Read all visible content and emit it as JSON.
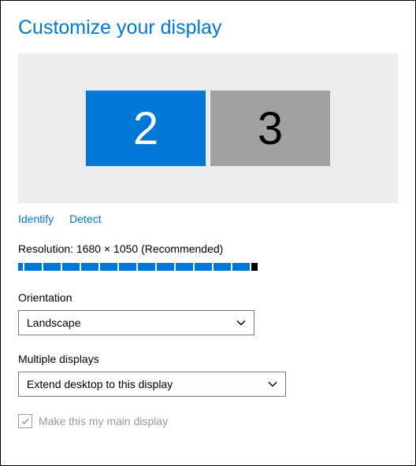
{
  "title": "Customize your display",
  "monitors": {
    "selected": "2",
    "unselected": "3"
  },
  "links": {
    "identify": "Identify",
    "detect": "Detect"
  },
  "resolution_label": "Resolution: 1680 × 1050 (Recommended)",
  "orientation": {
    "label": "Orientation",
    "value": "Landscape"
  },
  "multiple_displays": {
    "label": "Multiple displays",
    "value": "Extend desktop to this display"
  },
  "main_display_checkbox": {
    "label": "Make this my main display",
    "checked": true
  }
}
